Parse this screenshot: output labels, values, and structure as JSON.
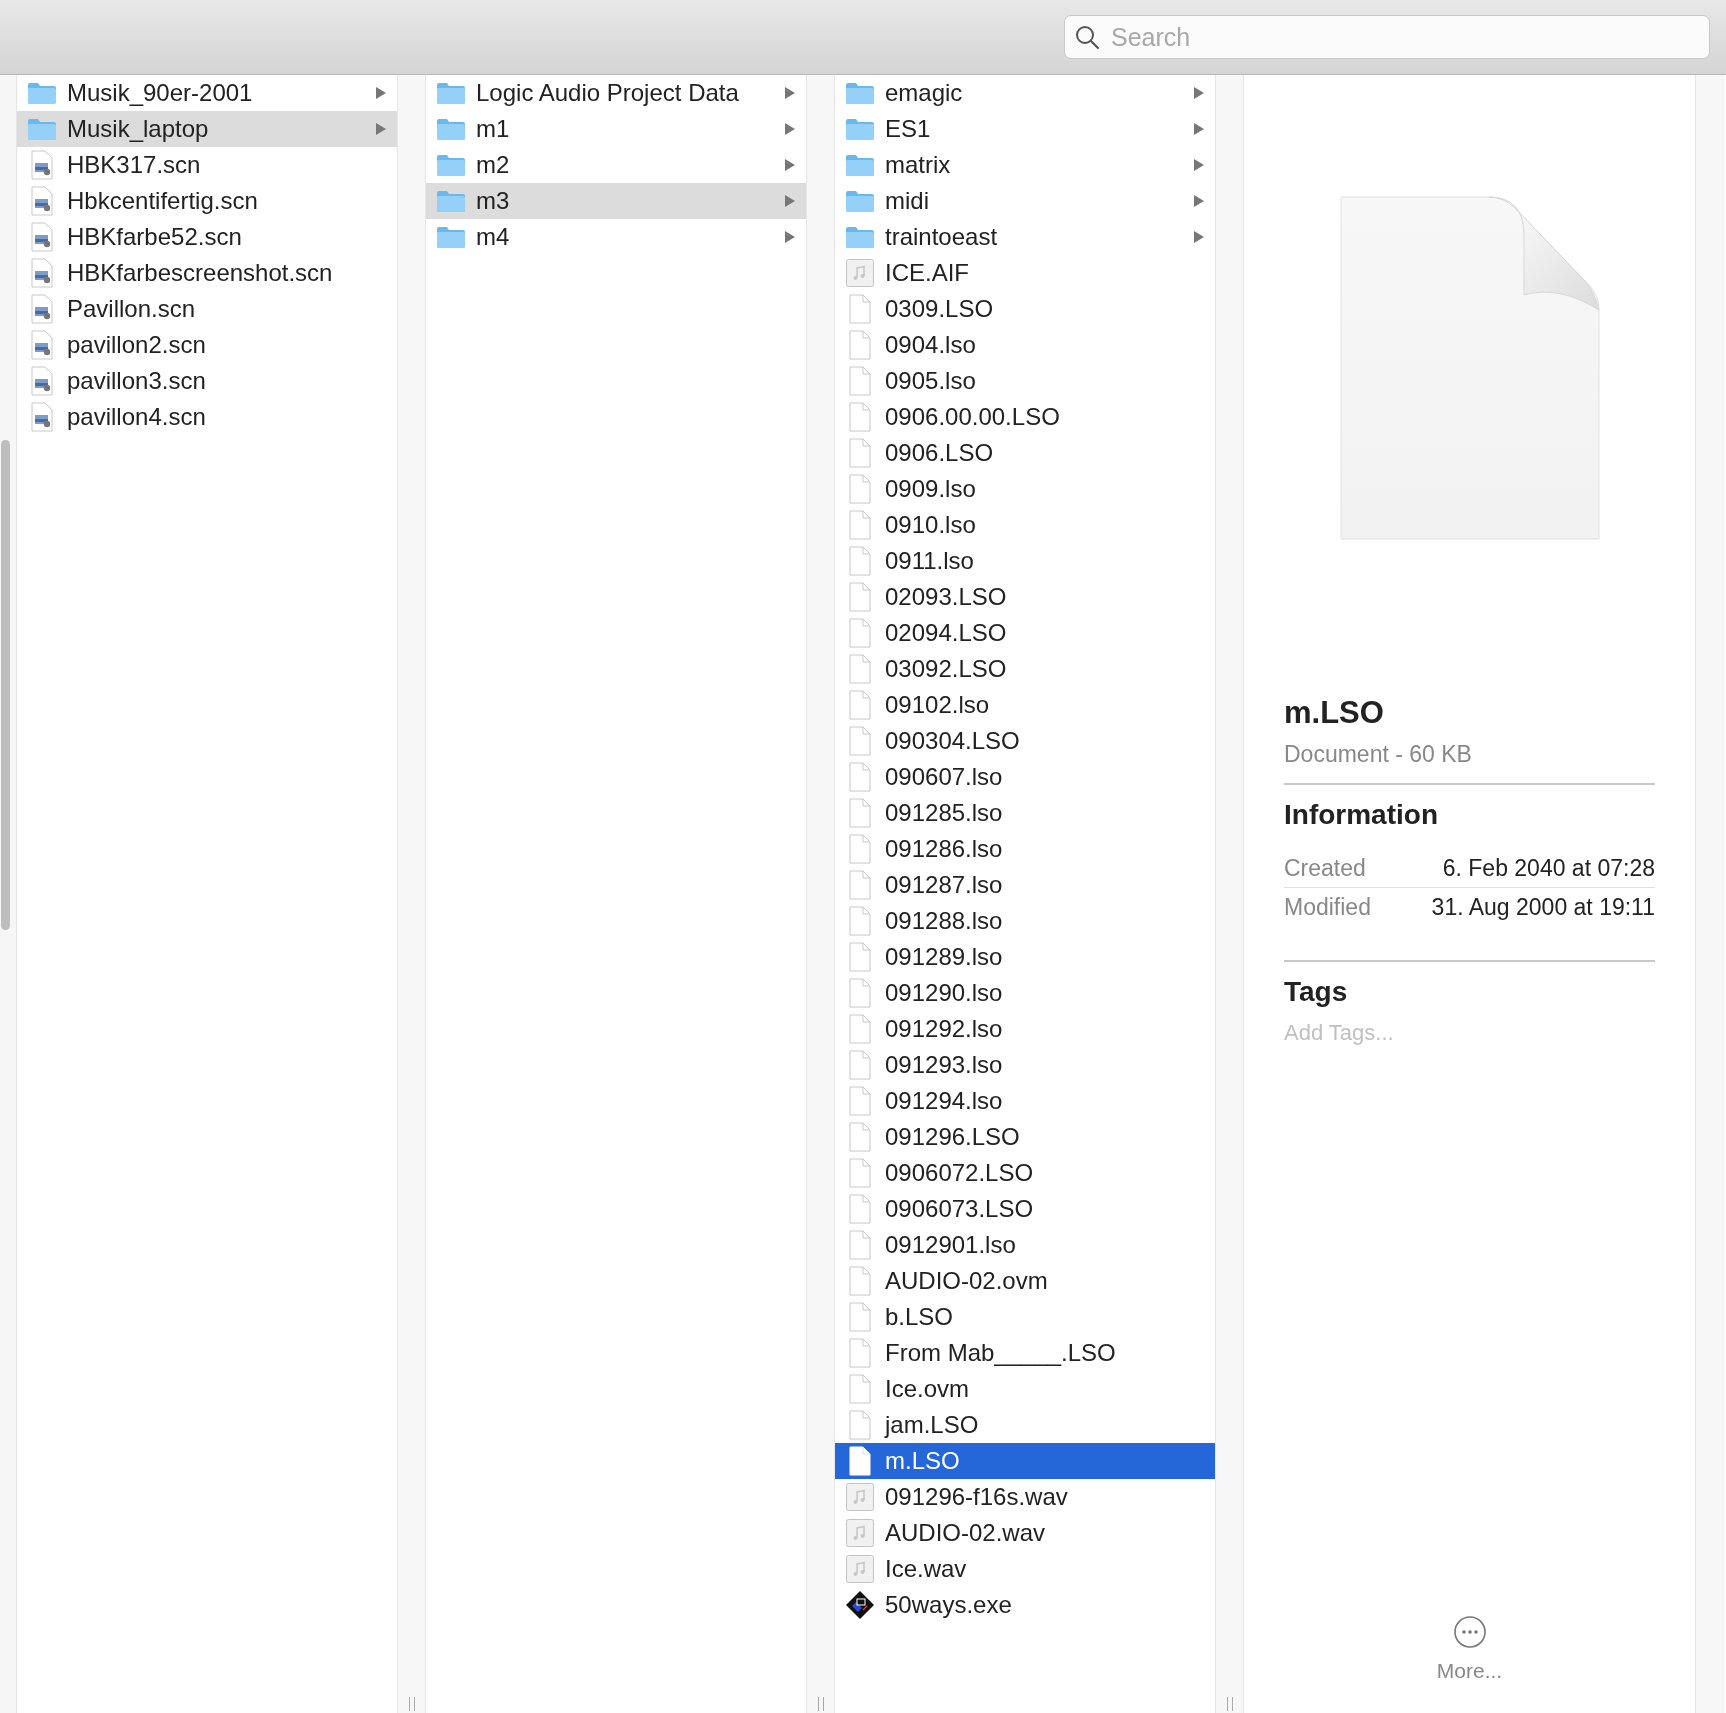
{
  "toolbar": {
    "search": {
      "placeholder": "Search"
    }
  },
  "columns": [
    {
      "focused": false,
      "items": [
        {
          "name": "Musik_90er-2001",
          "kind": "folder",
          "selected": false
        },
        {
          "name": "Musik_laptop",
          "kind": "folder",
          "selected": true
        },
        {
          "name": "HBK317.scn",
          "kind": "scn",
          "selected": false
        },
        {
          "name": "Hbkcentifertig.scn",
          "kind": "scn",
          "selected": false
        },
        {
          "name": "HBKfarbe52.scn",
          "kind": "scn",
          "selected": false
        },
        {
          "name": "HBKfarbescreenshot.scn",
          "kind": "scn",
          "selected": false
        },
        {
          "name": "Pavillon.scn",
          "kind": "scn",
          "selected": false
        },
        {
          "name": "pavillon2.scn",
          "kind": "scn",
          "selected": false
        },
        {
          "name": "pavillon3.scn",
          "kind": "scn",
          "selected": false
        },
        {
          "name": "pavillon4.scn",
          "kind": "scn",
          "selected": false
        }
      ]
    },
    {
      "focused": false,
      "items": [
        {
          "name": "Logic Audio Project Data",
          "kind": "folder",
          "selected": false
        },
        {
          "name": "m1",
          "kind": "folder",
          "selected": false
        },
        {
          "name": "m2",
          "kind": "folder",
          "selected": false
        },
        {
          "name": "m3",
          "kind": "folder",
          "selected": true
        },
        {
          "name": "m4",
          "kind": "folder",
          "selected": false
        }
      ]
    },
    {
      "focused": true,
      "items": [
        {
          "name": "emagic",
          "kind": "folder",
          "selected": false
        },
        {
          "name": "ES1",
          "kind": "folder",
          "selected": false
        },
        {
          "name": "matrix",
          "kind": "folder",
          "selected": false
        },
        {
          "name": "midi",
          "kind": "folder",
          "selected": false
        },
        {
          "name": "traintoeast",
          "kind": "folder",
          "selected": false
        },
        {
          "name": "ICE.AIF",
          "kind": "audio",
          "selected": false
        },
        {
          "name": "0309.LSO",
          "kind": "doc",
          "selected": false
        },
        {
          "name": "0904.lso",
          "kind": "doc",
          "selected": false
        },
        {
          "name": "0905.lso",
          "kind": "doc",
          "selected": false
        },
        {
          "name": "0906.00.00.LSO",
          "kind": "doc",
          "selected": false
        },
        {
          "name": "0906.LSO",
          "kind": "doc",
          "selected": false
        },
        {
          "name": "0909.lso",
          "kind": "doc",
          "selected": false
        },
        {
          "name": "0910.lso",
          "kind": "doc",
          "selected": false
        },
        {
          "name": "0911.lso",
          "kind": "doc",
          "selected": false
        },
        {
          "name": "02093.LSO",
          "kind": "doc",
          "selected": false
        },
        {
          "name": "02094.LSO",
          "kind": "doc",
          "selected": false
        },
        {
          "name": "03092.LSO",
          "kind": "doc",
          "selected": false
        },
        {
          "name": "09102.lso",
          "kind": "doc",
          "selected": false
        },
        {
          "name": "090304.LSO",
          "kind": "doc",
          "selected": false
        },
        {
          "name": "090607.lso",
          "kind": "doc",
          "selected": false
        },
        {
          "name": "091285.lso",
          "kind": "doc",
          "selected": false
        },
        {
          "name": "091286.lso",
          "kind": "doc",
          "selected": false
        },
        {
          "name": "091287.lso",
          "kind": "doc",
          "selected": false
        },
        {
          "name": "091288.lso",
          "kind": "doc",
          "selected": false
        },
        {
          "name": "091289.lso",
          "kind": "doc",
          "selected": false
        },
        {
          "name": "091290.lso",
          "kind": "doc",
          "selected": false
        },
        {
          "name": "091292.lso",
          "kind": "doc",
          "selected": false
        },
        {
          "name": "091293.lso",
          "kind": "doc",
          "selected": false
        },
        {
          "name": "091294.lso",
          "kind": "doc",
          "selected": false
        },
        {
          "name": "091296.LSO",
          "kind": "doc",
          "selected": false
        },
        {
          "name": "0906072.LSO",
          "kind": "doc",
          "selected": false
        },
        {
          "name": "0906073.LSO",
          "kind": "doc",
          "selected": false
        },
        {
          "name": "0912901.lso",
          "kind": "doc",
          "selected": false
        },
        {
          "name": "AUDIO-02.ovm",
          "kind": "doc",
          "selected": false
        },
        {
          "name": "b.LSO",
          "kind": "doc",
          "selected": false
        },
        {
          "name": "From Mab_____.LSO",
          "kind": "doc",
          "selected": false
        },
        {
          "name": "Ice.ovm",
          "kind": "doc",
          "selected": false
        },
        {
          "name": "jam.LSO",
          "kind": "doc",
          "selected": false
        },
        {
          "name": "m.LSO",
          "kind": "doc",
          "selected": true
        },
        {
          "name": "091296-f16s.wav",
          "kind": "audio",
          "selected": false
        },
        {
          "name": "AUDIO-02.wav",
          "kind": "audio",
          "selected": false
        },
        {
          "name": "Ice.wav",
          "kind": "audio",
          "selected": false
        },
        {
          "name": "50ways.exe",
          "kind": "exe",
          "selected": false
        }
      ]
    }
  ],
  "preview": {
    "title": "m.LSO",
    "subtitle": "Document - 60 KB",
    "information_heading": "Information",
    "information": [
      {
        "label": "Created",
        "value": "6. Feb 2040 at 07:28"
      },
      {
        "label": "Modified",
        "value": "31. Aug 2000 at 19:11"
      }
    ],
    "tags_heading": "Tags",
    "tags_placeholder": "Add Tags...",
    "more_label": "More..."
  }
}
